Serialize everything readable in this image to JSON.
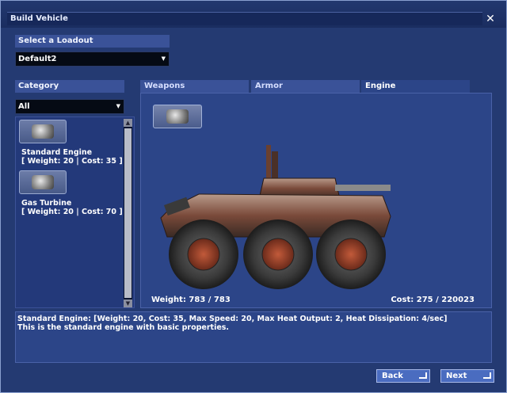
{
  "window": {
    "title": "Build Vehicle",
    "close_glyph": "✕"
  },
  "loadout": {
    "label": "Select a Loadout",
    "selected": "Default2"
  },
  "category": {
    "label": "Category",
    "selected": "All"
  },
  "items": [
    {
      "name": "Standard Engine",
      "stats": "[ Weight: 20 | Cost: 35 ]",
      "icon": "engine-icon"
    },
    {
      "name": "Gas Turbine",
      "stats": "[ Weight: 20 | Cost: 70 ]",
      "icon": "engine-icon"
    }
  ],
  "tabs": [
    {
      "label": "Weapons",
      "active": false
    },
    {
      "label": "Armor",
      "active": false
    },
    {
      "label": "Engine",
      "active": true
    }
  ],
  "preview": {
    "slot_icon": "engine-icon",
    "weight": "Weight: 783 / 783",
    "cost": "Cost: 275 / 220023"
  },
  "description": {
    "line1": "Standard Engine: [Weight: 20, Cost: 35, Max Speed: 20, Max Heat Output: 2, Heat Dissipation: 4/sec]",
    "line2": "This is the standard engine with basic properties."
  },
  "buttons": {
    "back": "Back",
    "next": "Next"
  },
  "colors": {
    "panel": "#2c4588",
    "header": "#3a5298",
    "window": "#243a72"
  }
}
